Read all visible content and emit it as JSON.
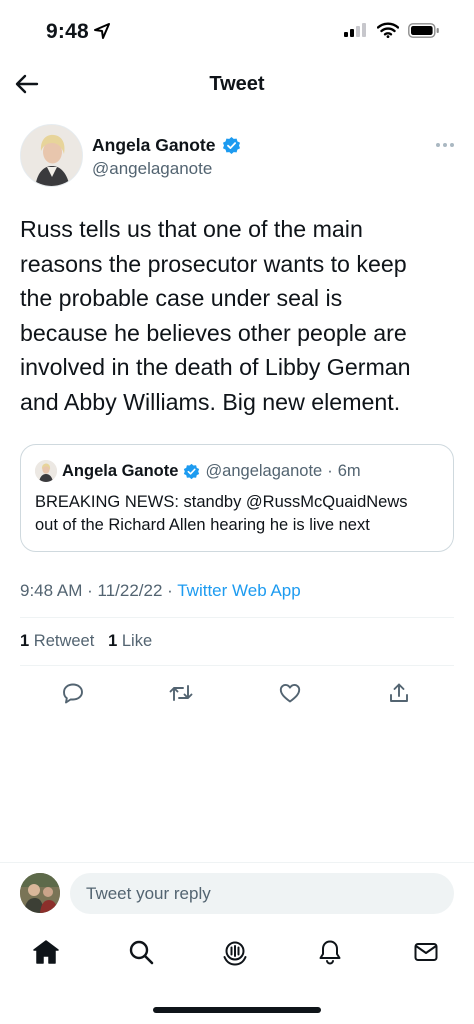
{
  "status_bar": {
    "time": "9:48"
  },
  "nav": {
    "title": "Tweet"
  },
  "tweet": {
    "author_name": "Angela Ganote",
    "author_handle": "@angelaganote",
    "text": "Russ tells us that one of the main\nreasons the prosecutor wants to keep\nthe probable case under seal is\nbecause he believes other people are\ninvolved in the death of Libby German\nand Abby Williams. Big new element.",
    "time": "9:48 AM",
    "date": "11/22/22",
    "source": "Twitter Web App",
    "retweet_count": "1",
    "retweet_label": "Retweet",
    "like_count": "1",
    "like_label": "Like"
  },
  "quote": {
    "author_name": "Angela Ganote",
    "author_handle": "@angelaganote",
    "age": "6m",
    "text": "BREAKING NEWS: standby @RussMcQuaidNews\nout of the Richard Allen hearing he is live next"
  },
  "reply": {
    "placeholder": "Tweet your reply"
  },
  "colors": {
    "accent": "#1d9bf0",
    "text": "#0f1419",
    "secondary": "#536471",
    "border": "#cfd9de"
  }
}
